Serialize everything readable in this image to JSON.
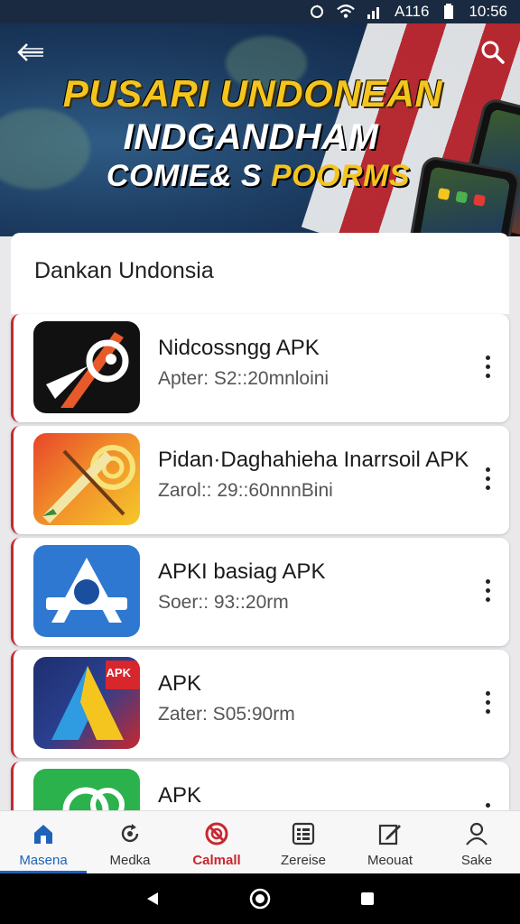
{
  "status_bar": {
    "signal_text": "A116",
    "time": "10:56"
  },
  "hero": {
    "line1": "PUSARI UNDONEAN",
    "line2": "INDGANDHAM",
    "line3_a": "COMIE& S ",
    "line3_b": "POORMS"
  },
  "section": {
    "title": "Dankan Undonsia"
  },
  "apps": [
    {
      "name": "Nidcossngg APK",
      "meta": "Apter: S2::20mnloini"
    },
    {
      "name": "Pidan·Daghahieha Inarrsoil APK",
      "meta": "Zarol:: 29::60nnnBini"
    },
    {
      "name": "APKI basiag APK",
      "meta": "Soer:: 93::20rm"
    },
    {
      "name": "APK",
      "meta": "Zater: S05:90rm",
      "icon_badge": "APK"
    },
    {
      "name": "APK",
      "meta": ""
    }
  ],
  "bottom_nav": [
    {
      "label": "Masena",
      "icon": "home-icon"
    },
    {
      "label": "Medka",
      "icon": "refresh-icon"
    },
    {
      "label": "Calmall",
      "icon": "target-icon"
    },
    {
      "label": "Zereise",
      "icon": "list-icon"
    },
    {
      "label": "Meouat",
      "icon": "edit-icon"
    },
    {
      "label": "Sake",
      "icon": "person-icon"
    }
  ],
  "colors": {
    "accent": "#1f63b8",
    "brand_red": "#c7282e",
    "hero_yellow": "#f4c51e"
  }
}
